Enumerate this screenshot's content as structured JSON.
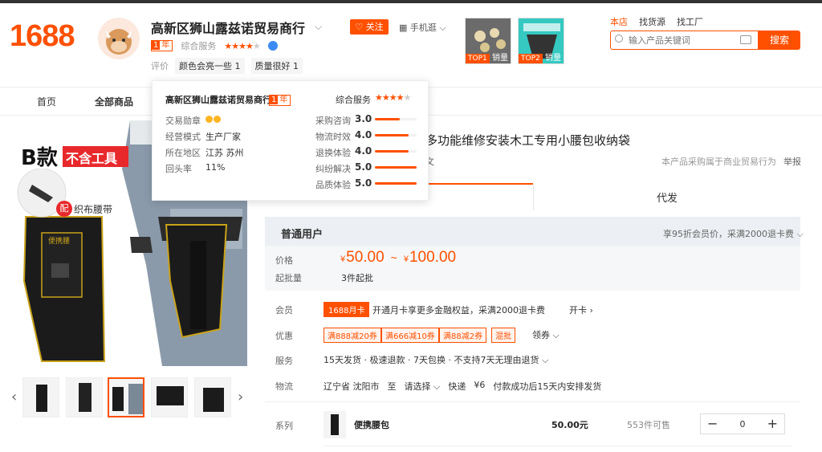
{
  "brand": {
    "logo": "1688"
  },
  "shop": {
    "name": "高新区狮山露兹诺贸易商行",
    "year_num": "1",
    "year_unit": "年",
    "service_label": "综合服务",
    "eval_label": "评价",
    "eval_tags": [
      "颜色会亮一些 1",
      "质量很好 1"
    ],
    "follow": "关注",
    "mobile": "手机逛"
  },
  "top_products": [
    {
      "rank": "TOP1",
      "sales": "销量"
    },
    {
      "rank": "TOP2",
      "sales": "销量"
    }
  ],
  "top_links": {
    "store": "本店",
    "find_source": "找货源",
    "find_factory": "找工厂"
  },
  "search": {
    "placeholder": "输入产品关键词",
    "button": "搜索"
  },
  "nav": {
    "home": "首页",
    "all_products": "全部商品"
  },
  "popup": {
    "title": "高新区狮山露兹诺贸易商行",
    "service_label": "综合服务",
    "left": [
      {
        "label": "交易勋章",
        "value": ""
      },
      {
        "label": "经营模式",
        "value": "生产厂家"
      },
      {
        "label": "所在地区",
        "value": "江苏 苏州"
      },
      {
        "label": "回头率",
        "value": "11%"
      }
    ],
    "scores": [
      {
        "label": "采购咨询",
        "score": "3.0",
        "pct": 0.6
      },
      {
        "label": "物流时效",
        "score": "4.0",
        "pct": 0.8
      },
      {
        "label": "退换体验",
        "score": "4.0",
        "pct": 0.8
      },
      {
        "label": "纠纷解决",
        "score": "5.0",
        "pct": 1.0
      },
      {
        "label": "品质体验",
        "score": "5.0",
        "pct": 1.0
      }
    ]
  },
  "main_image": {
    "label_b": "B款",
    "label_notools": "不含工具",
    "belt_badge": "配",
    "belt_text": "织布腰带",
    "brand_label": "便携腰"
  },
  "product": {
    "title": "多功能维修安装木工专用小腰包收纳袋",
    "subtitle": "文",
    "info_note": "本产品采购属于商业贸易行为",
    "report": "举报"
  },
  "tabs": {
    "agent": "代发"
  },
  "price": {
    "user_type": "普通用户",
    "vip_note": "享95折会员价，采满2000退卡费",
    "label": "价格",
    "currency": "¥",
    "min": "50.00",
    "sep": "~",
    "max": "100.00",
    "moq_label": "起批量",
    "moq": "3件起批"
  },
  "member": {
    "label": "会员",
    "badge": "1688月卡",
    "text": "开通月卡享更多金融权益，采满2000退卡费",
    "open": "开卡"
  },
  "offers": {
    "label": "优惠",
    "coupons": [
      "满888减20券",
      "满666减10券",
      "满88减2券",
      "混批"
    ],
    "more": "领券"
  },
  "service": {
    "label": "服务",
    "text": "15天发货 · 极速退款 · 7天包换 · 不支持7天无理由退货"
  },
  "logistics": {
    "label": "物流",
    "from": "辽宁省 沈阳市",
    "to_word": "至",
    "to": "请选择",
    "express": "快递",
    "fee": "¥6",
    "ship": "付款成功后15天内安排发货"
  },
  "sku": {
    "label": "系列",
    "name": "便携腰包",
    "price": "50.00元",
    "stock": "553件可售",
    "qty": "0",
    "minus": "−",
    "plus": "+"
  }
}
